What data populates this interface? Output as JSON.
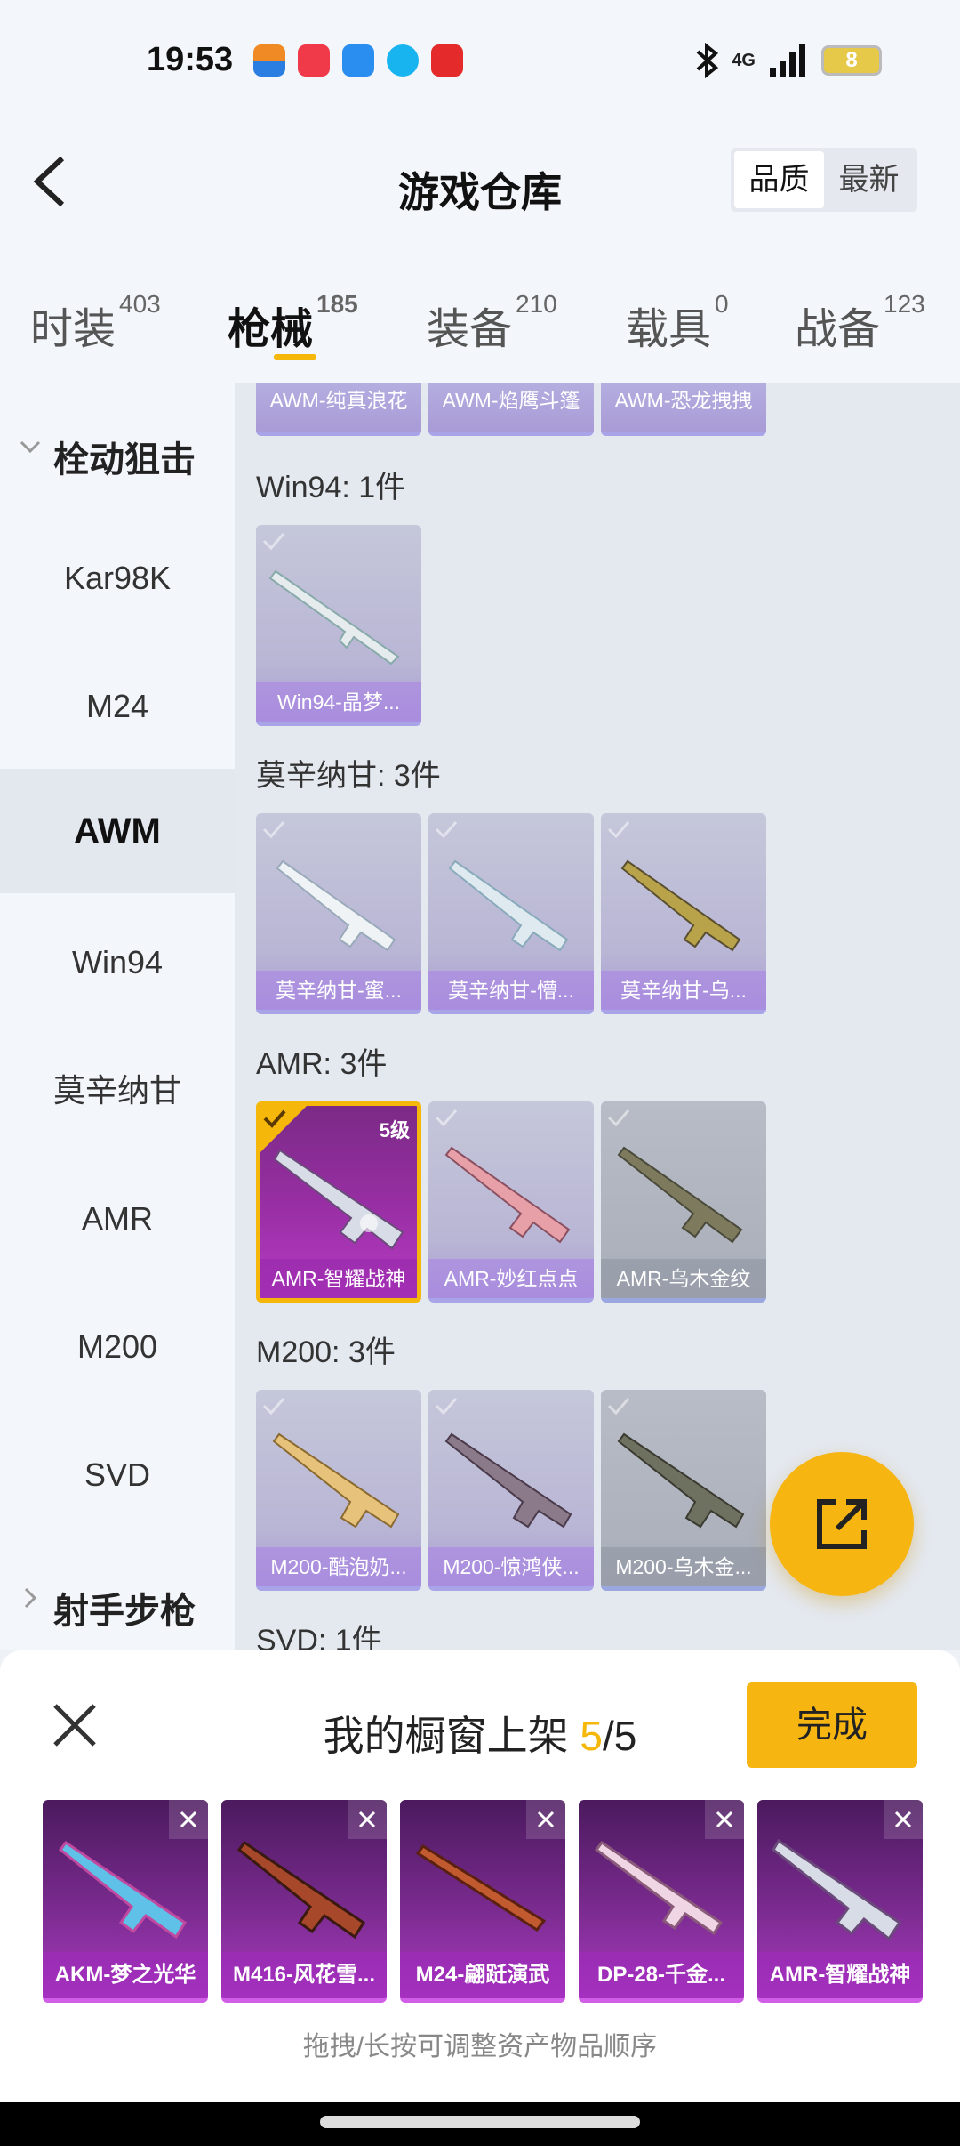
{
  "status_bar": {
    "time": "19:53",
    "battery": "8",
    "network": "4G"
  },
  "header": {
    "title": "游戏仓库",
    "sort_options": [
      "品质",
      "最新"
    ],
    "sort_active": "品质"
  },
  "tabs": [
    {
      "label": "时装",
      "count": "403"
    },
    {
      "label": "枪械",
      "count": "185"
    },
    {
      "label": "装备",
      "count": "210"
    },
    {
      "label": "载具",
      "count": "0"
    },
    {
      "label": "战备",
      "count": "123"
    }
  ],
  "sidebar": {
    "category_top": "栓动狙击",
    "items": [
      "Kar98K",
      "M24",
      "AWM",
      "Win94",
      "莫辛纳甘",
      "AMR",
      "M200",
      "SVD"
    ],
    "active_item": "AWM",
    "category_bottom": "射手步枪"
  },
  "content": {
    "top_cut_cards": [
      "AWM-纯真浪花",
      "AWM-焰鹰斗篷",
      "AWM-恐龙拽拽"
    ],
    "groups": [
      {
        "title": "Win94: 1件",
        "items": [
          "Win94-晶梦..."
        ]
      },
      {
        "title": "莫辛纳甘: 3件",
        "items": [
          "莫辛纳甘-蜜...",
          "莫辛纳甘-懵...",
          "莫辛纳甘-乌..."
        ]
      },
      {
        "title": "AMR: 3件",
        "items": [
          "AMR-智耀战神",
          "AMR-妙红点点",
          "AMR-乌木金纹"
        ],
        "selected_level": "5级"
      },
      {
        "title": "M200: 3件",
        "items": [
          "M200-酷泡奶...",
          "M200-惊鸿侠...",
          "M200-乌木金..."
        ]
      },
      {
        "title": "SVD: 1件"
      }
    ]
  },
  "sheet": {
    "title_prefix": "我的橱窗上架 ",
    "count_current": "5",
    "count_total": "/5",
    "done_label": "完成",
    "items": [
      "AKM-梦之光华",
      "M416-风花雪...",
      "M24-翩跹演武",
      "DP-28-千金...",
      "AMR-智耀战神"
    ],
    "hint": "拖拽/长按可调整资产物品顺序"
  },
  "colors": {
    "accent": "#f5b70a",
    "selected_card": "#9a2fa6",
    "card_lavender": "#b9b6d5"
  }
}
